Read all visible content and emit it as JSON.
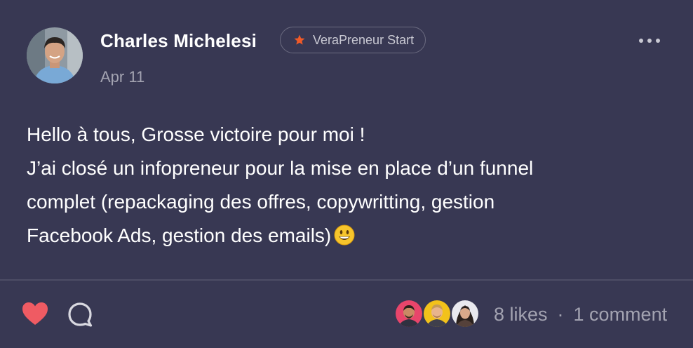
{
  "post": {
    "author": "Charles Michelesi",
    "badge": "VeraPreneur Start",
    "date": "Apr 11",
    "lines": [
      "Hello à tous, Grosse victoire pour moi !",
      "J’ai closé un infopreneur pour la mise en place d’un funnel",
      "complet (repackaging des offres, copywritting, gestion",
      "Facebook Ads, gestion des emails)"
    ],
    "emoji": "smiling-face-emoji"
  },
  "footer": {
    "likes": "8 likes",
    "separator": "·",
    "comments": "1 comment"
  },
  "colors": {
    "background": "#383853",
    "heart": "#ef5b63",
    "badge_star": "#f05a28"
  }
}
